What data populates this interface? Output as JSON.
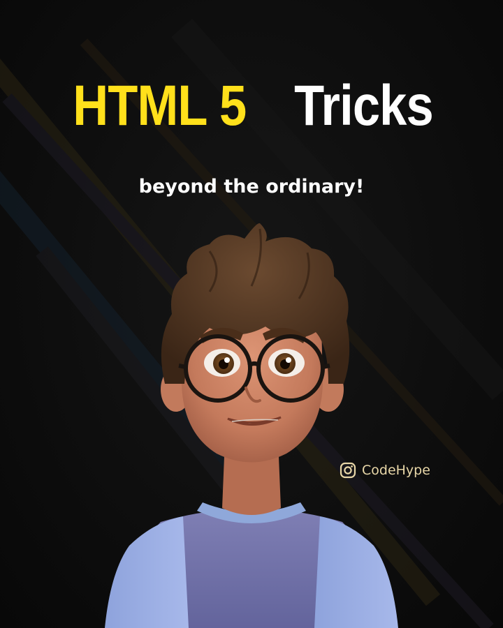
{
  "title": {
    "part_yellow": "HTML 5",
    "part_white": "Tricks",
    "color_yellow": "#ffe01b",
    "color_white": "#ffffff"
  },
  "subtitle": "beyond the ordinary!",
  "brand": {
    "icon": "instagram-icon",
    "handle": "CodeHype",
    "color": "#e8d7a8"
  },
  "background_color": "#0c0c0c"
}
